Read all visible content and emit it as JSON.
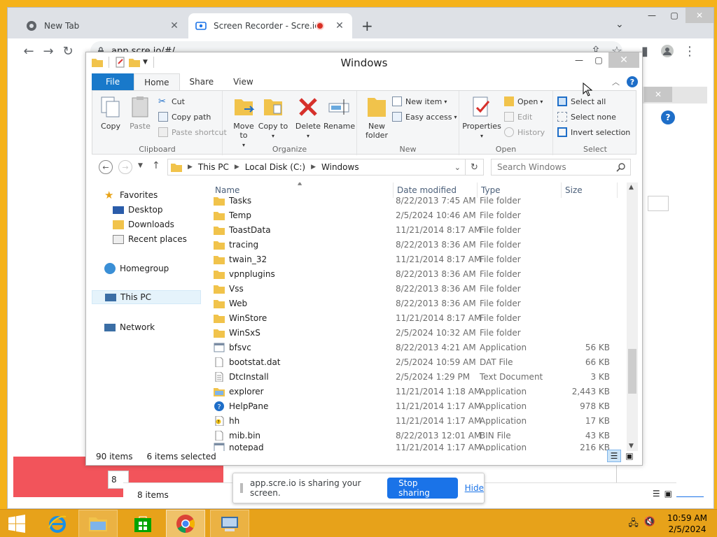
{
  "browser": {
    "tabs": [
      {
        "title": "New Tab",
        "active": false
      },
      {
        "title": "Screen Recorder - Scre.io",
        "active": true,
        "recording": true
      }
    ],
    "url": "app.scre.io/#/",
    "page": {
      "small_input_value": "8",
      "status_items": "8 items"
    }
  },
  "explorer": {
    "title": "Windows",
    "ribbon_tabs": [
      "File",
      "Home",
      "Share",
      "View"
    ],
    "ribbon": {
      "clipboard": {
        "label": "Clipboard",
        "copy": "Copy",
        "paste": "Paste",
        "cut": "Cut",
        "copy_path": "Copy path",
        "paste_shortcut": "Paste shortcut"
      },
      "organize": {
        "label": "Organize",
        "move_to": "Move to",
        "copy_to": "Copy to",
        "delete": "Delete",
        "rename": "Rename"
      },
      "new": {
        "label": "New",
        "new_folder": "New folder",
        "new_item": "New item",
        "easy_access": "Easy access"
      },
      "open": {
        "label": "Open",
        "properties": "Properties",
        "open": "Open",
        "edit": "Edit",
        "history": "History"
      },
      "select": {
        "label": "Select",
        "select_all": "Select all",
        "select_none": "Select none",
        "invert_selection": "Invert selection"
      }
    },
    "address": {
      "segments": [
        "This PC",
        "Local Disk (C:)",
        "Windows"
      ],
      "search_placeholder": "Search Windows"
    },
    "nav": {
      "favorites": "Favorites",
      "desktop": "Desktop",
      "downloads": "Downloads",
      "recent": "Recent places",
      "homegroup": "Homegroup",
      "this_pc": "This PC",
      "network": "Network"
    },
    "columns": {
      "name": "Name",
      "date": "Date modified",
      "type": "Type",
      "size": "Size"
    },
    "files": [
      {
        "name": "Tasks",
        "date": "8/22/2013 7:45 AM",
        "type": "File folder",
        "size": "",
        "icon": "folder"
      },
      {
        "name": "Temp",
        "date": "2/5/2024 10:46 AM",
        "type": "File folder",
        "size": "",
        "icon": "folder"
      },
      {
        "name": "ToastData",
        "date": "11/21/2014 8:17 AM",
        "type": "File folder",
        "size": "",
        "icon": "folder"
      },
      {
        "name": "tracing",
        "date": "8/22/2013 8:36 AM",
        "type": "File folder",
        "size": "",
        "icon": "folder"
      },
      {
        "name": "twain_32",
        "date": "11/21/2014 8:17 AM",
        "type": "File folder",
        "size": "",
        "icon": "folder"
      },
      {
        "name": "vpnplugins",
        "date": "8/22/2013 8:36 AM",
        "type": "File folder",
        "size": "",
        "icon": "folder"
      },
      {
        "name": "Vss",
        "date": "8/22/2013 8:36 AM",
        "type": "File folder",
        "size": "",
        "icon": "folder"
      },
      {
        "name": "Web",
        "date": "8/22/2013 8:36 AM",
        "type": "File folder",
        "size": "",
        "icon": "folder"
      },
      {
        "name": "WinStore",
        "date": "11/21/2014 8:17 AM",
        "type": "File folder",
        "size": "",
        "icon": "folder"
      },
      {
        "name": "WinSxS",
        "date": "2/5/2024 10:32 AM",
        "type": "File folder",
        "size": "",
        "icon": "folder"
      },
      {
        "name": "bfsvc",
        "date": "8/22/2013 4:21 AM",
        "type": "Application",
        "size": "56 KB",
        "icon": "app"
      },
      {
        "name": "bootstat.dat",
        "date": "2/5/2024 10:59 AM",
        "type": "DAT File",
        "size": "66 KB",
        "icon": "file"
      },
      {
        "name": "DtcInstall",
        "date": "2/5/2024 1:29 PM",
        "type": "Text Document",
        "size": "3 KB",
        "icon": "text"
      },
      {
        "name": "explorer",
        "date": "11/21/2014 1:18 AM",
        "type": "Application",
        "size": "2,443 KB",
        "icon": "explorer"
      },
      {
        "name": "HelpPane",
        "date": "11/21/2014 1:17 AM",
        "type": "Application",
        "size": "978 KB",
        "icon": "help"
      },
      {
        "name": "hh",
        "date": "11/21/2014 1:17 AM",
        "type": "Application",
        "size": "17 KB",
        "icon": "hh"
      },
      {
        "name": "mib.bin",
        "date": "8/22/2013 12:01 AM",
        "type": "BIN File",
        "size": "43 KB",
        "icon": "file"
      },
      {
        "name": "notepad",
        "date": "11/21/2014 1:17 AM",
        "type": "Application",
        "size": "216 KB",
        "icon": "app"
      }
    ],
    "status": {
      "count": "90 items",
      "selected": "6 items selected"
    }
  },
  "sharebar": {
    "message": "app.scre.io is sharing your screen.",
    "stop": "Stop sharing",
    "hide": "Hide"
  },
  "taskbar": {
    "time": "10:59 AM",
    "date": "2/5/2024"
  },
  "colors": {
    "desktop": "#f5b21a",
    "taskbar": "#e7a21a",
    "file_tab": "#1979ca",
    "accent_blue": "#1a73e8",
    "record_red": "#d93025"
  }
}
